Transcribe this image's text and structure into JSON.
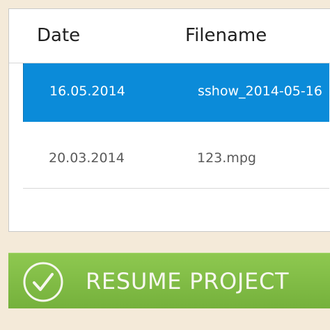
{
  "table": {
    "columns": [
      "Date",
      "Filename"
    ],
    "rows": [
      {
        "date": "16.05.2014",
        "filename": "sshow_2014-05-16",
        "selected": true
      },
      {
        "date": "20.03.2014",
        "filename": "123.mpg",
        "selected": false
      }
    ]
  },
  "resume_button": {
    "label": "RESUME PROJECT",
    "icon": "checkmark-circle-icon",
    "color": "#7fbd44"
  },
  "colors": {
    "background": "#f4ead9",
    "selection": "#0b8bd9",
    "header_text": "#1f1f1f",
    "row_text": "#5a5a5a"
  }
}
